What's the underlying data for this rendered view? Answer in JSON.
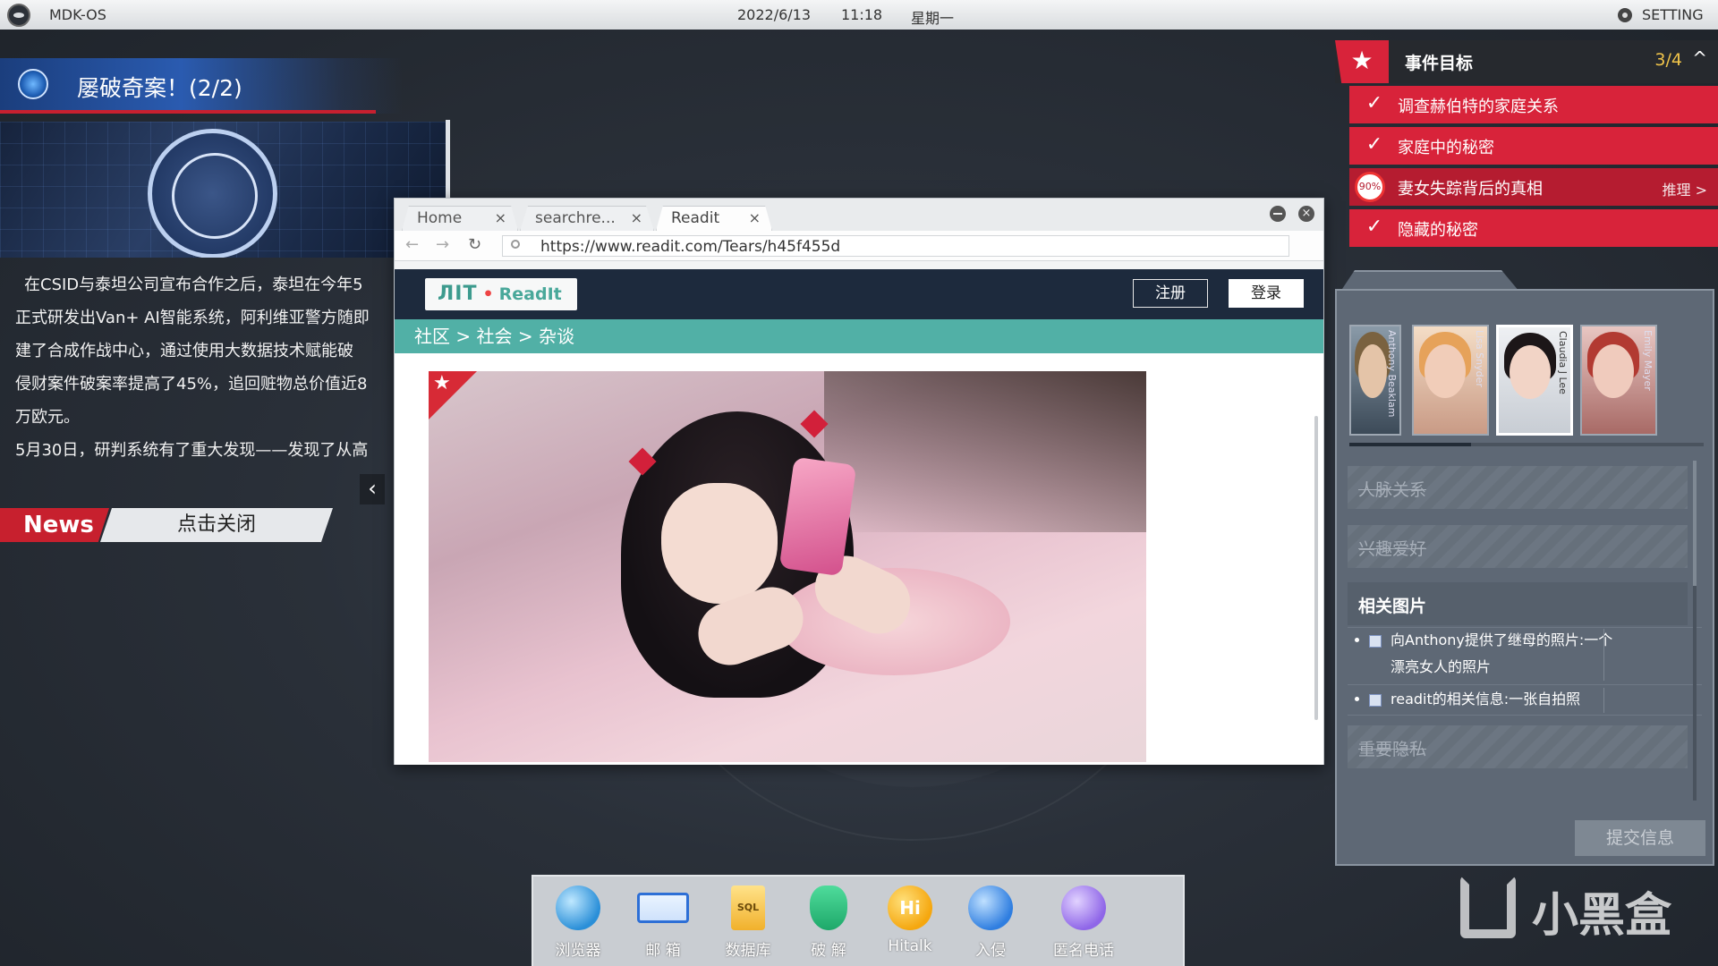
{
  "topbar": {
    "os_name": "MDK-OS",
    "date": "2022/6/13",
    "time": "11:18",
    "weekday": "星期一",
    "setting_label": "SETTING"
  },
  "news": {
    "title": "屡破奇案！(2/2)",
    "paragraphs": [
      "在CSID与泰坦公司宣布合作之后，泰坦在今年5",
      "正式研发出Van+ AI智能系统，阿利维亚警方随即",
      "建了合成作战中心，通过使用大数据技术赋能破",
      "侵财案件破案率提高了45%，追回赃物总价值近8",
      "万欧元。",
      "5月30日，研判系统有了重大发现——发现了从高"
    ],
    "tag": "News",
    "close_label": "点击关闭",
    "prev_icon": "‹"
  },
  "browser": {
    "tabs": [
      {
        "label": "Home",
        "close": "×"
      },
      {
        "label": "searchre...",
        "close": "×"
      },
      {
        "label": "Readit",
        "close": "×"
      }
    ],
    "nav": {
      "back": "←",
      "forward": "→",
      "reload": "↻"
    },
    "url": "https://www.readit.com/Tears/h45f455d",
    "site": {
      "logo_mark": "ЛIT",
      "logo_dot": "•",
      "logo_name": "ReadIt",
      "register": "注册",
      "login": "登录",
      "breadcrumb": "社区 > 社会 > 杂谈"
    },
    "post": {
      "star": "★"
    },
    "close_icon": "×"
  },
  "objectives": {
    "title": "事件目标",
    "count": "3/4",
    "collapse_icon": "^",
    "star_icon": "★",
    "items": [
      {
        "label": "调查赫伯特的家庭关系",
        "status": "done",
        "icon": "✓"
      },
      {
        "label": "家庭中的秘密",
        "status": "done",
        "icon": "✓"
      },
      {
        "label": "妻女失踪背后的真相",
        "status": "progress",
        "progress": "90%",
        "action": "推理 >"
      },
      {
        "label": "隐藏的秘密",
        "status": "done",
        "icon": "✓"
      }
    ]
  },
  "dossier": {
    "portraits": [
      {
        "name": "Anthony Beaklam"
      },
      {
        "name": "Lisa Snyder"
      },
      {
        "name": "Claudia J Lee"
      },
      {
        "name": "Emily Mayer"
      }
    ],
    "sections": [
      {
        "label": "人脉关系"
      },
      {
        "label": "兴趣爱好"
      },
      {
        "label": "相关图片"
      },
      {
        "label": "重要隐私"
      }
    ],
    "clues": [
      {
        "text": "向Anthony提供了继母的照片:一个漂亮女人的照片"
      },
      {
        "text": "readit的相关信息:一张自拍照"
      }
    ],
    "submit_label": "提交信息"
  },
  "dock": [
    {
      "label": "浏览器",
      "icon": "globe-icon"
    },
    {
      "label": "邮  箱",
      "icon": "mail-icon"
    },
    {
      "label": "数据库",
      "icon": "database-icon"
    },
    {
      "label": "破  解",
      "icon": "shield-icon"
    },
    {
      "label": "Hitalk",
      "icon": "chat-icon"
    },
    {
      "label": "入侵",
      "icon": "hook-icon"
    },
    {
      "label": "匿名电话",
      "icon": "phone-icon"
    }
  ],
  "dock_glyphs": {
    "database": "SQL",
    "hitalk": "Hi"
  },
  "watermark": {
    "text": "小黑盒"
  },
  "colors": {
    "accent_red": "#d8233a",
    "readit_teal": "#51b0a6",
    "readit_navy": "#1d2a3d",
    "progress_yellow": "#f0c44a"
  }
}
